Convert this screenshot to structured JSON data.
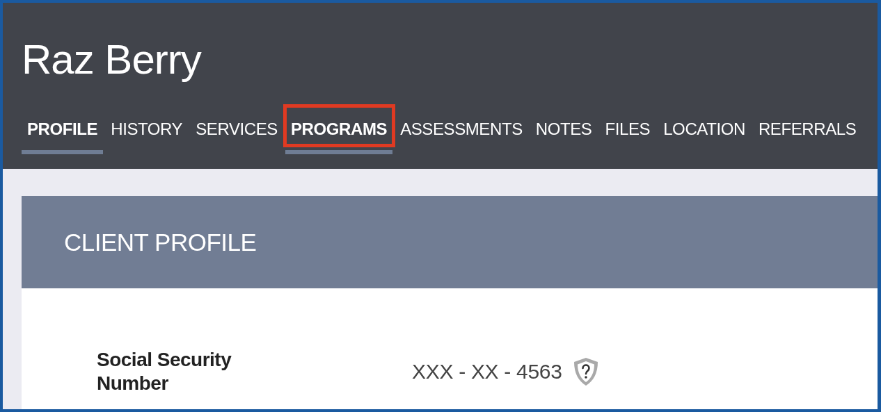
{
  "client": {
    "name": "Raz Berry"
  },
  "tabs": [
    {
      "label": "PROFILE",
      "selected": true,
      "highlighted": false
    },
    {
      "label": "HISTORY",
      "selected": false,
      "highlighted": false
    },
    {
      "label": "SERVICES",
      "selected": false,
      "highlighted": false
    },
    {
      "label": "PROGRAMS",
      "selected": true,
      "highlighted": true
    },
    {
      "label": "ASSESSMENTS",
      "selected": false,
      "highlighted": false
    },
    {
      "label": "NOTES",
      "selected": false,
      "highlighted": false
    },
    {
      "label": "FILES",
      "selected": false,
      "highlighted": false
    },
    {
      "label": "LOCATION",
      "selected": false,
      "highlighted": false
    },
    {
      "label": "REFERRALS",
      "selected": false,
      "highlighted": false
    }
  ],
  "card": {
    "title": "CLIENT PROFILE",
    "fields": [
      {
        "label": "Social Security Number",
        "value": "XXX - XX - 4563"
      }
    ]
  }
}
